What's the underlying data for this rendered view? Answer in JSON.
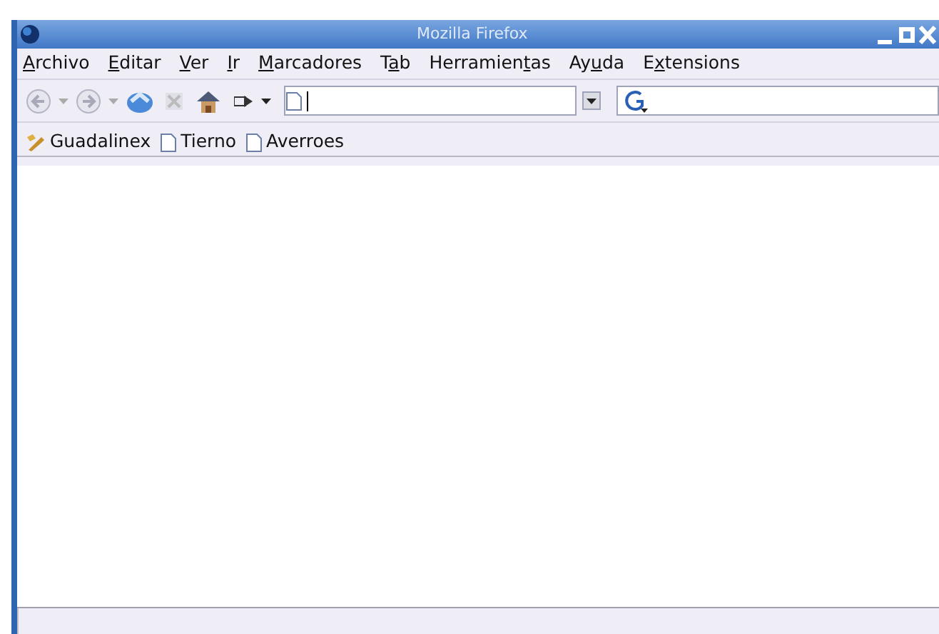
{
  "window": {
    "title": "Mozilla Firefox"
  },
  "menu": [
    {
      "key": "A",
      "after": "rchivo"
    },
    {
      "key": "E",
      "after": "ditar"
    },
    {
      "key": "V",
      "after": "er"
    },
    {
      "key": "I",
      "after": "r"
    },
    {
      "key": "M",
      "after": "arcadores"
    },
    {
      "before": "T",
      "key": "a",
      "after": "b"
    },
    {
      "before": "Herramien",
      "key": "t",
      "after": "as"
    },
    {
      "before": "Ay",
      "key": "u",
      "after": "da"
    },
    {
      "before": "E",
      "key": "x",
      "after": "tensions"
    }
  ],
  "bookmarks": [
    {
      "label": "Guadalinex",
      "kind": "star"
    },
    {
      "label": "Tierno",
      "kind": "page"
    },
    {
      "label": "Averroes",
      "kind": "page"
    }
  ]
}
